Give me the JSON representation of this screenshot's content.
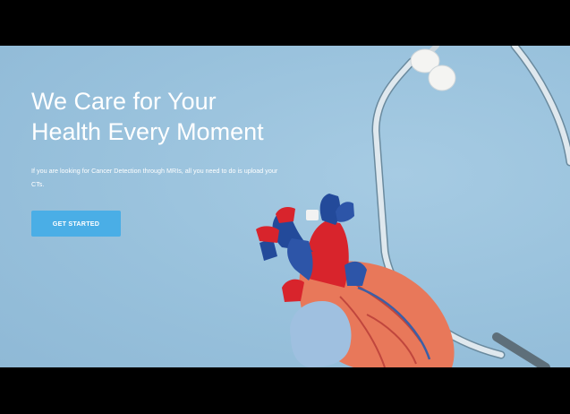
{
  "hero": {
    "headline_line1": "We Care for Your",
    "headline_line2": "Health Every Moment",
    "subtext": "If you are looking for Cancer Detection through MRIs, all you need to do is upload your CTs.",
    "cta_label": "GET STARTED"
  },
  "colors": {
    "background": "#9cc4de",
    "button": "#4aaee6",
    "text": "#ffffff"
  },
  "images": {
    "heart_model": "anatomical-heart-model",
    "stethoscope": "stethoscope"
  }
}
